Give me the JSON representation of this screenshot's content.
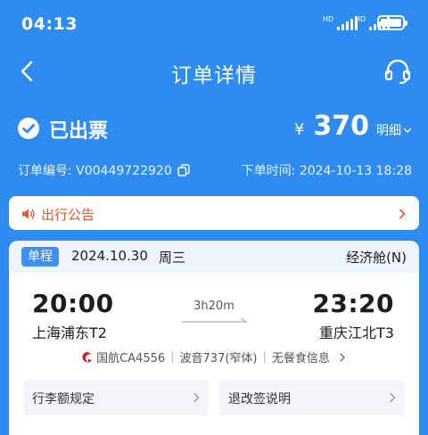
{
  "status_bar": {
    "time": "04:13",
    "signal1_icon": "signal-icon",
    "signal2_icon": "signal-icon",
    "battery_icon": "battery-icon"
  },
  "nav": {
    "title": "订单详情",
    "back_icon": "back-arrow-icon",
    "service_icon": "headset-icon"
  },
  "order": {
    "status": "已出票",
    "currency": "¥",
    "price": "370",
    "detail_label": "明细",
    "order_no": "订单编号: V00449722920",
    "order_time": "下单时间: 2024-10-13 18:28"
  },
  "notice": {
    "label": "出行公告"
  },
  "flight": {
    "trip_type": "单程",
    "date": "2024.10.30",
    "weekday": "周三",
    "cabin": "经济舱(N)",
    "dep_time": "20:00",
    "dep_airport": "上海浦东T2",
    "arr_time": "23:20",
    "arr_airport": "重庆江北T3",
    "duration": "3h20m",
    "airline": "国航CA4556",
    "aircraft": "波音737(窄体)",
    "meal": "无餐食信息"
  },
  "rules": {
    "baggage": "行李额规定",
    "refund": "退改签说明"
  },
  "colors": {
    "primary": "#2E8CF0",
    "notice": "#E8572A",
    "badge": "#3F8FF0",
    "airline": "#D71920"
  }
}
